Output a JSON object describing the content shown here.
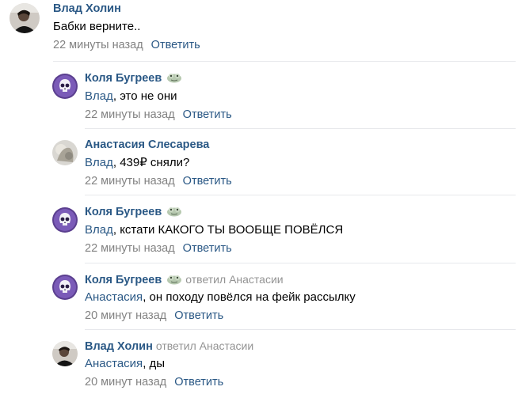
{
  "comments": [
    {
      "author": "Влад Холин",
      "text": "Бабки верните..",
      "time": "22 минуты назад",
      "reply_label": "Ответить"
    },
    {
      "author": "Коля Бугреев",
      "mention": "Влад",
      "text": ", это не они",
      "time": "22 минуты назад",
      "reply_label": "Ответить",
      "badge_icon": "frog-sticker-icon"
    },
    {
      "author": "Анастасия Слесарева",
      "mention": "Влад",
      "text": ", 439₽ сняли?",
      "time": "22 минуты назад",
      "reply_label": "Ответить"
    },
    {
      "author": "Коля Бугреев",
      "mention": "Влад",
      "text": ", кстати КАКОГО ТЫ ВООБЩЕ ПОВЁЛСЯ",
      "time": "22 минуты назад",
      "reply_label": "Ответить",
      "badge_icon": "frog-sticker-icon"
    },
    {
      "author": "Коля Бугреев",
      "replied_to": "ответил Анастасии",
      "mention": "Анастасия",
      "text": ", он походу повёлся на фейк рассылку",
      "time": "20 минут назад",
      "reply_label": "Ответить",
      "badge_icon": "frog-sticker-icon"
    },
    {
      "author": "Влад Холин",
      "replied_to": "ответил Анастасии",
      "mention": "Анастасия",
      "text": ", ды",
      "time": "20 минут назад",
      "reply_label": "Ответить"
    }
  ],
  "colors": {
    "link": "#2a5885",
    "meta": "#828282",
    "replied": "#939393",
    "separator": "#e7e8ec"
  }
}
